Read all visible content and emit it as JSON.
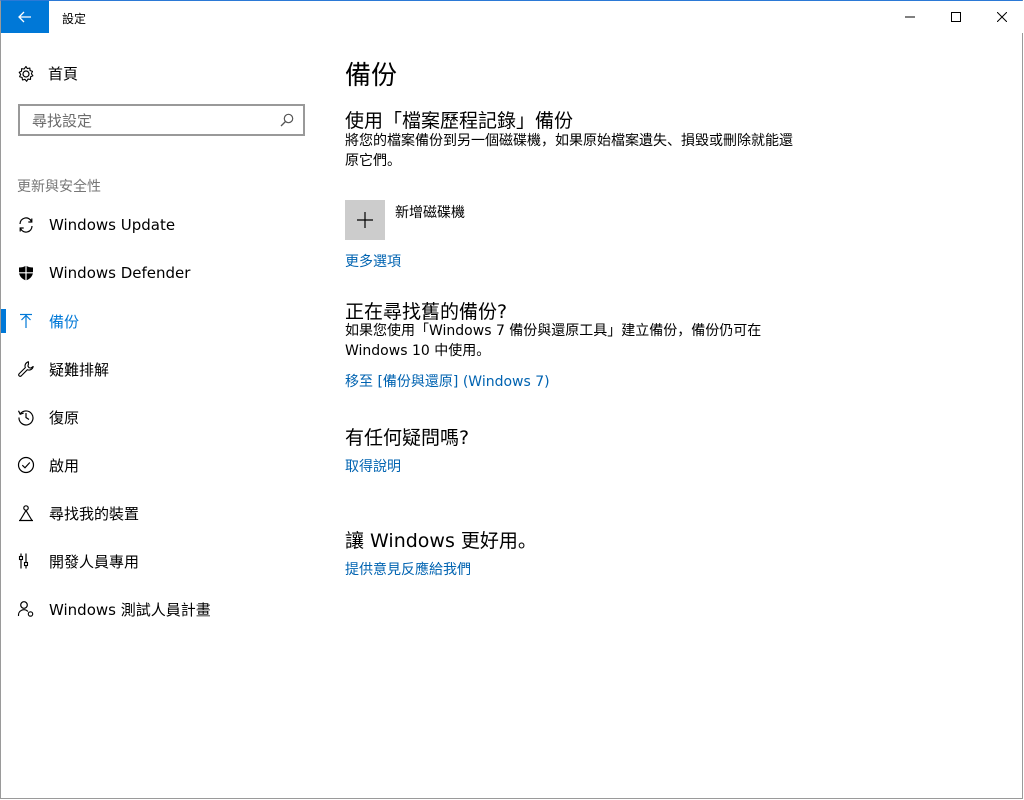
{
  "titlebar": {
    "title": "設定"
  },
  "sidebar": {
    "home_label": "首頁",
    "search_placeholder": "尋找設定",
    "section_label": "更新與安全性",
    "items": [
      {
        "label": "Windows Update",
        "icon": "sync-icon"
      },
      {
        "label": "Windows Defender",
        "icon": "shield-icon"
      },
      {
        "label": "備份",
        "icon": "upload-arrow-icon",
        "active": true
      },
      {
        "label": "疑難排解",
        "icon": "wrench-icon"
      },
      {
        "label": "復原",
        "icon": "history-icon"
      },
      {
        "label": "啟用",
        "icon": "checkmark-circle-icon"
      },
      {
        "label": "尋找我的裝置",
        "icon": "find-device-icon"
      },
      {
        "label": "開發人員專用",
        "icon": "developer-tools-icon"
      },
      {
        "label": "Windows 測試人員計畫",
        "icon": "insider-icon"
      }
    ]
  },
  "main": {
    "title": "備份",
    "file_history": {
      "heading": "使用「檔案歷程記錄」備份",
      "description": "將您的檔案備份到另一個磁碟機，如果原始檔案遺失、損毀或刪除就能還原它們。",
      "add_drive_label": "新增磁碟機",
      "more_options_link": "更多選項"
    },
    "older_backup": {
      "heading": "正在尋找舊的備份?",
      "description": "如果您使用「Windows 7 備份與還原工具」建立備份，備份仍可在 Windows 10 中使用。",
      "link": "移至 [備份與還原] (Windows 7)"
    },
    "questions": {
      "heading": "有任何疑問嗎?",
      "link": "取得說明"
    },
    "feedback": {
      "heading": "讓 Windows 更好用。",
      "link": "提供意見反應給我們"
    }
  },
  "colors": {
    "accent": "#0078d7",
    "link": "#0063b1",
    "tile": "#cccccc"
  }
}
